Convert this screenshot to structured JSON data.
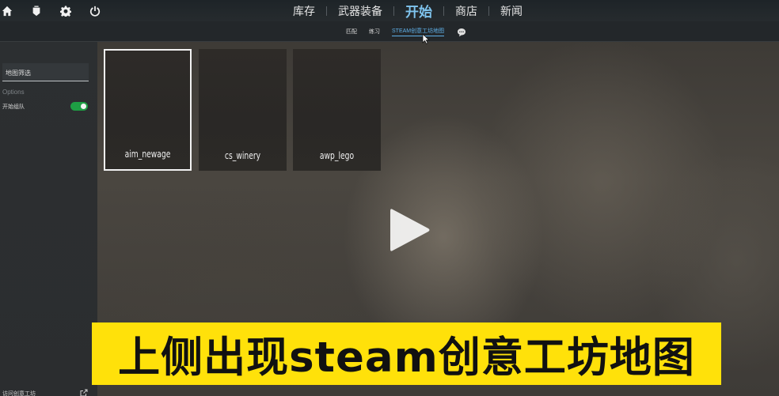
{
  "nav": {
    "tabs": [
      {
        "label": "库存",
        "active": false
      },
      {
        "label": "武器装备",
        "active": false
      },
      {
        "label": "开始",
        "active": true
      },
      {
        "label": "商店",
        "active": false
      },
      {
        "label": "新闻",
        "active": false
      }
    ],
    "icons": [
      "home-icon",
      "ranking-icon",
      "gear-icon",
      "power-icon"
    ]
  },
  "subnav": {
    "tabs": [
      {
        "label": "匹配",
        "active": false
      },
      {
        "label": "练习",
        "active": false
      },
      {
        "label": "STEAM创意工坊地图",
        "active": true
      }
    ],
    "chat_icon": "chat-icon"
  },
  "sidebar": {
    "filter_placeholder": "地图筛选",
    "options_label": "Options",
    "toggle_label": "开始组队",
    "toggle_on": true,
    "bottom_link": "访问创意工坊"
  },
  "maps": [
    {
      "name": "aim_newage",
      "selected": true
    },
    {
      "name": "cs_winery",
      "selected": false
    },
    {
      "name": "awp_lego",
      "selected": false
    }
  ],
  "video": {
    "play_icon": "play-icon"
  },
  "caption": {
    "text": "上侧出现steam创意工坊地图"
  },
  "colors": {
    "accent_blue": "#7fc4ee",
    "toggle_green": "#1e9e44",
    "caption_yellow": "#ffe10a"
  }
}
